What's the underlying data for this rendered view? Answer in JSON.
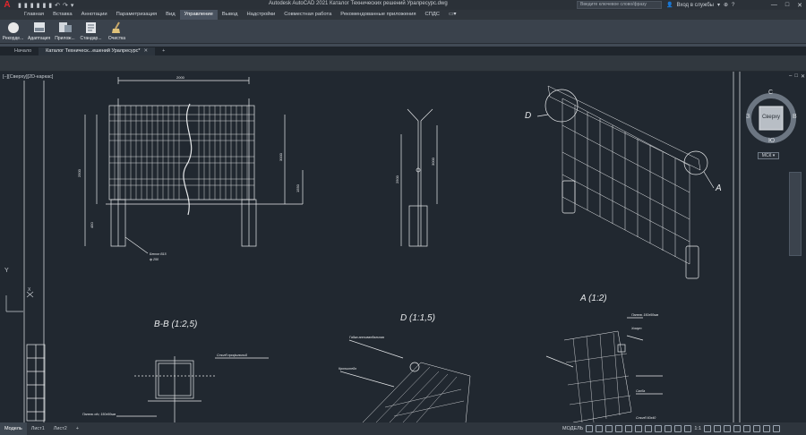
{
  "app": {
    "logo": "A",
    "title": "Autodesk AutoCAD 2021   Каталог Технических решений Уралресурс.dwg"
  },
  "quick_access": [
    "▮",
    "▮",
    "▮",
    "▮",
    "▮",
    "▮",
    "↶",
    "↷",
    "▾"
  ],
  "search": {
    "placeholder": "Введите ключевое слово/фразу"
  },
  "account": {
    "signin": "Вход в службы",
    "dropdown": "▾"
  },
  "window_buttons": {
    "minimize": "—",
    "maximize": "□",
    "close": "✕"
  },
  "menu_tabs": [
    "Главная",
    "Вставка",
    "Аннотации",
    "Параметризация",
    "Вид",
    "Управление",
    "Вывод",
    "Надстройки",
    "Совместная работа",
    "Рекомендованные приложения",
    "СПДС",
    "▭▾"
  ],
  "active_menu_tab": "Управление",
  "ribbon_buttons": [
    {
      "label": "Рекорде..."
    },
    {
      "label": "Адаптация"
    },
    {
      "label": "Прилож..."
    },
    {
      "label": "Стандар..."
    },
    {
      "label": "Очистка"
    }
  ],
  "doc_tabs": [
    {
      "label": "Начало",
      "active": false
    },
    {
      "label": "Каталог Техническ...ешений Уралресурс*",
      "active": true,
      "close": "✕"
    }
  ],
  "new_tab": "+",
  "viewport": {
    "label": "[–][Сверху][2D-каркас]"
  },
  "viewcube": {
    "face": "Сверху",
    "n": "С",
    "s": "Ю",
    "w": "З",
    "e": "В",
    "wcs": "МСК ▾"
  },
  "drawing_labels": {
    "section_bb": "B-B (1:2,5)",
    "section_d": "D (1:1,5)",
    "section_a": "A (1:2)",
    "callout_d": "D",
    "callout_a": "A",
    "axis_y": "Y",
    "axis_x": "X",
    "dim_top": "2000",
    "dim_h1": "2500",
    "dim_h2": "3000",
    "dim_1550": "1550",
    "dim_2500": "2500",
    "dim_3000": "3000",
    "dim_450": "450",
    "note1": "Бетон В15",
    "note2": "ф 250",
    "note3": "Панель ofo; 150х50мм",
    "note4": "Кронштейн",
    "note5": "Хомут",
    "note6": "Столб профильный",
    "note7": "Гайка антивандальная",
    "note8": "Скоба",
    "note9": "Панель 150x50мм",
    "note10": "Столб 60х40"
  },
  "status_tabs": [
    {
      "label": "Модель",
      "active": true
    },
    {
      "label": "Лист1",
      "active": false
    },
    {
      "label": "Лист2",
      "active": false
    },
    {
      "label": "+",
      "active": false
    }
  ],
  "status_right": {
    "model": "МОДЕЛЬ",
    "scale": "1:1"
  }
}
